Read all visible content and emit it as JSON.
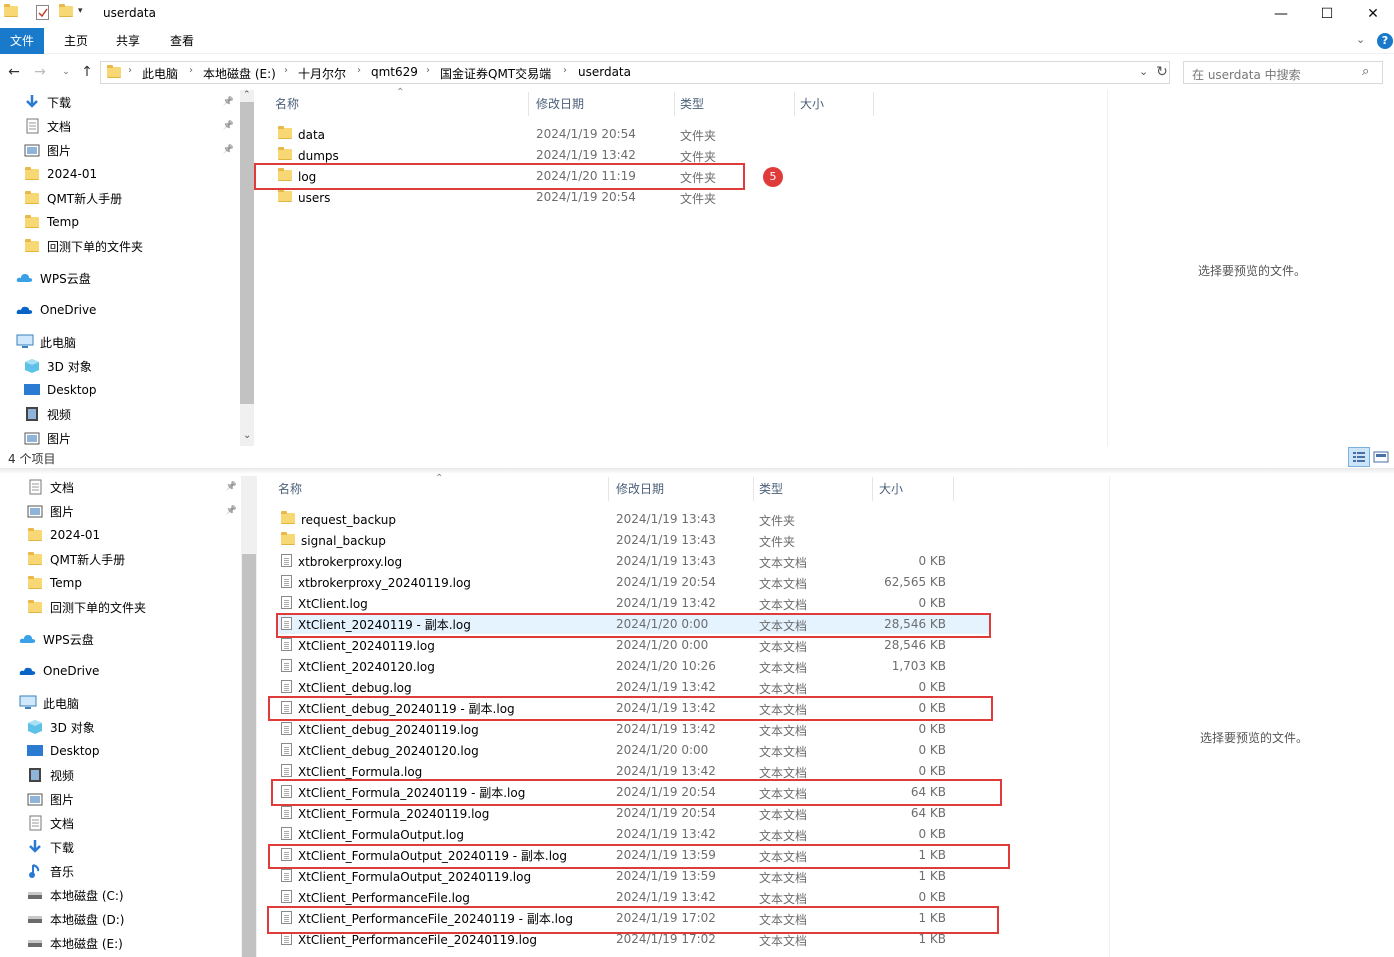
{
  "window": {
    "title": "userdata",
    "minimize": "—",
    "maximize": "☐",
    "close": "✕"
  },
  "ribbon": {
    "tabs": [
      "文件",
      "主页",
      "共享",
      "查看"
    ]
  },
  "address": {
    "crumbs": [
      "此电脑",
      "本地磁盘 (E:)",
      "十月尔尔",
      "qmt629",
      "国金证券QMT交易端",
      "userdata"
    ],
    "search_placeholder": "在 userdata 中搜索"
  },
  "top_pane": {
    "nav_items": [
      {
        "label": "下载",
        "icon": "download-icon",
        "pinned": true
      },
      {
        "label": "文档",
        "icon": "document-icon",
        "pinned": true
      },
      {
        "label": "图片",
        "icon": "picture-icon",
        "pinned": true
      },
      {
        "label": "2024-01",
        "icon": "folder-icon",
        "pinned": false
      },
      {
        "label": "QMT新人手册",
        "icon": "folder-icon",
        "pinned": false
      },
      {
        "label": "Temp",
        "icon": "folder-icon",
        "pinned": false
      },
      {
        "label": "回测下单的文件夹",
        "icon": "folder-icon",
        "pinned": false
      },
      {
        "label": "WPS云盘",
        "icon": "cloud-icon",
        "pinned": false
      },
      {
        "label": "OneDrive",
        "icon": "onedrive-icon",
        "pinned": false
      },
      {
        "label": "此电脑",
        "icon": "computer-icon",
        "pinned": false
      },
      {
        "label": "3D 对象",
        "icon": "cube-icon",
        "pinned": false
      },
      {
        "label": "Desktop",
        "icon": "desktop-icon",
        "pinned": false
      },
      {
        "label": "视频",
        "icon": "video-icon",
        "pinned": false
      },
      {
        "label": "图片",
        "icon": "picture-icon",
        "pinned": false
      }
    ],
    "columns": [
      "名称",
      "修改日期",
      "类型",
      "大小"
    ],
    "files": [
      {
        "name": "data",
        "date": "2024/1/19 20:54",
        "type": "文件夹",
        "size": ""
      },
      {
        "name": "dumps",
        "date": "2024/1/19 13:42",
        "type": "文件夹",
        "size": ""
      },
      {
        "name": "log",
        "date": "2024/1/20 11:19",
        "type": "文件夹",
        "size": ""
      },
      {
        "name": "users",
        "date": "2024/1/19 20:54",
        "type": "文件夹",
        "size": ""
      }
    ],
    "step_badge": "5",
    "preview_text": "选择要预览的文件。",
    "status": "4 个项目"
  },
  "bottom_pane": {
    "nav_items": [
      {
        "label": "文档",
        "icon": "document-icon",
        "pinned": true
      },
      {
        "label": "图片",
        "icon": "picture-icon",
        "pinned": true
      },
      {
        "label": "2024-01",
        "icon": "folder-icon",
        "pinned": false
      },
      {
        "label": "QMT新人手册",
        "icon": "folder-icon",
        "pinned": false
      },
      {
        "label": "Temp",
        "icon": "folder-icon",
        "pinned": false
      },
      {
        "label": "回测下单的文件夹",
        "icon": "folder-icon",
        "pinned": false
      },
      {
        "label": "WPS云盘",
        "icon": "cloud-icon",
        "pinned": false
      },
      {
        "label": "OneDrive",
        "icon": "onedrive-icon",
        "pinned": false
      },
      {
        "label": "此电脑",
        "icon": "computer-icon",
        "pinned": false
      },
      {
        "label": "3D 对象",
        "icon": "cube-icon",
        "pinned": false
      },
      {
        "label": "Desktop",
        "icon": "desktop-icon",
        "pinned": false
      },
      {
        "label": "视频",
        "icon": "video-icon",
        "pinned": false
      },
      {
        "label": "图片",
        "icon": "picture-icon",
        "pinned": false
      },
      {
        "label": "文档",
        "icon": "document-icon",
        "pinned": false
      },
      {
        "label": "下载",
        "icon": "download-icon",
        "pinned": false
      },
      {
        "label": "音乐",
        "icon": "music-icon",
        "pinned": false
      },
      {
        "label": "本地磁盘 (C:)",
        "icon": "drive-icon",
        "pinned": false
      },
      {
        "label": "本地磁盘 (D:)",
        "icon": "drive-icon",
        "pinned": false
      },
      {
        "label": "本地磁盘 (E:)",
        "icon": "drive-icon",
        "pinned": false
      }
    ],
    "columns": [
      "名称",
      "修改日期",
      "类型",
      "大小"
    ],
    "files": [
      {
        "name": "request_backup",
        "date": "2024/1/19 13:43",
        "type": "文件夹",
        "size": "",
        "folder": true
      },
      {
        "name": "signal_backup",
        "date": "2024/1/19 13:43",
        "type": "文件夹",
        "size": "",
        "folder": true
      },
      {
        "name": "xtbrokerproxy.log",
        "date": "2024/1/19 13:43",
        "type": "文本文档",
        "size": "0 KB"
      },
      {
        "name": "xtbrokerproxy_20240119.log",
        "date": "2024/1/19 20:54",
        "type": "文本文档",
        "size": "62,565 KB"
      },
      {
        "name": "XtClient.log",
        "date": "2024/1/19 13:42",
        "type": "文本文档",
        "size": "0 KB"
      },
      {
        "name": "XtClient_20240119 - 副本.log",
        "date": "2024/1/20 0:00",
        "type": "文本文档",
        "size": "28,546 KB"
      },
      {
        "name": "XtClient_20240119.log",
        "date": "2024/1/20 0:00",
        "type": "文本文档",
        "size": "28,546 KB"
      },
      {
        "name": "XtClient_20240120.log",
        "date": "2024/1/20 10:26",
        "type": "文本文档",
        "size": "1,703 KB"
      },
      {
        "name": "XtClient_debug.log",
        "date": "2024/1/19 13:42",
        "type": "文本文档",
        "size": "0 KB"
      },
      {
        "name": "XtClient_debug_20240119 - 副本.log",
        "date": "2024/1/19 13:42",
        "type": "文本文档",
        "size": "0 KB"
      },
      {
        "name": "XtClient_debug_20240119.log",
        "date": "2024/1/19 13:42",
        "type": "文本文档",
        "size": "0 KB"
      },
      {
        "name": "XtClient_debug_20240120.log",
        "date": "2024/1/20 0:00",
        "type": "文本文档",
        "size": "0 KB"
      },
      {
        "name": "XtClient_Formula.log",
        "date": "2024/1/19 13:42",
        "type": "文本文档",
        "size": "0 KB"
      },
      {
        "name": "XtClient_Formula_20240119 - 副本.log",
        "date": "2024/1/19 20:54",
        "type": "文本文档",
        "size": "64 KB"
      },
      {
        "name": "XtClient_Formula_20240119.log",
        "date": "2024/1/19 20:54",
        "type": "文本文档",
        "size": "64 KB"
      },
      {
        "name": "XtClient_FormulaOutput.log",
        "date": "2024/1/19 13:42",
        "type": "文本文档",
        "size": "0 KB"
      },
      {
        "name": "XtClient_FormulaOutput_20240119 - 副本.log",
        "date": "2024/1/19 13:59",
        "type": "文本文档",
        "size": "1 KB"
      },
      {
        "name": "XtClient_FormulaOutput_20240119.log",
        "date": "2024/1/19 13:59",
        "type": "文本文档",
        "size": "1 KB"
      },
      {
        "name": "XtClient_PerformanceFile.log",
        "date": "2024/1/19 13:42",
        "type": "文本文档",
        "size": "0 KB"
      },
      {
        "name": "XtClient_PerformanceFile_20240119 - 副本.log",
        "date": "2024/1/19 17:02",
        "type": "文本文档",
        "size": "1 KB"
      },
      {
        "name": "XtClient_PerformanceFile_20240119.log",
        "date": "2024/1/19 17:02",
        "type": "文本文档",
        "size": "1 KB"
      }
    ],
    "preview_text": "选择要预览的文件。"
  },
  "colors": {
    "accent": "#1979ca",
    "highlight_box": "#e03b3b",
    "badge": "#e03b3b",
    "selection": "#e5f3ff"
  }
}
